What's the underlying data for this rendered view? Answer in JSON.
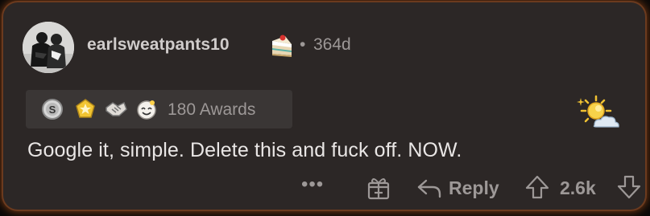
{
  "comment": {
    "username": "earlsweatpants10",
    "separator": "•",
    "age": "364d",
    "awards_label": "180 Awards",
    "award_icons": [
      "silver-award-icon",
      "helpful-award-icon",
      "handshake-award-icon",
      "wholesome-award-icon"
    ],
    "body": "Google it, simple. Delete this and fuck off. NOW.",
    "actions": {
      "more": "•••",
      "reply_label": "Reply",
      "score": "2.6k"
    }
  },
  "colors": {
    "card_background": "#2c2726",
    "glow_border": "#c85f1e",
    "text_primary": "#e9e6e5",
    "text_secondary": "#9d9897"
  }
}
